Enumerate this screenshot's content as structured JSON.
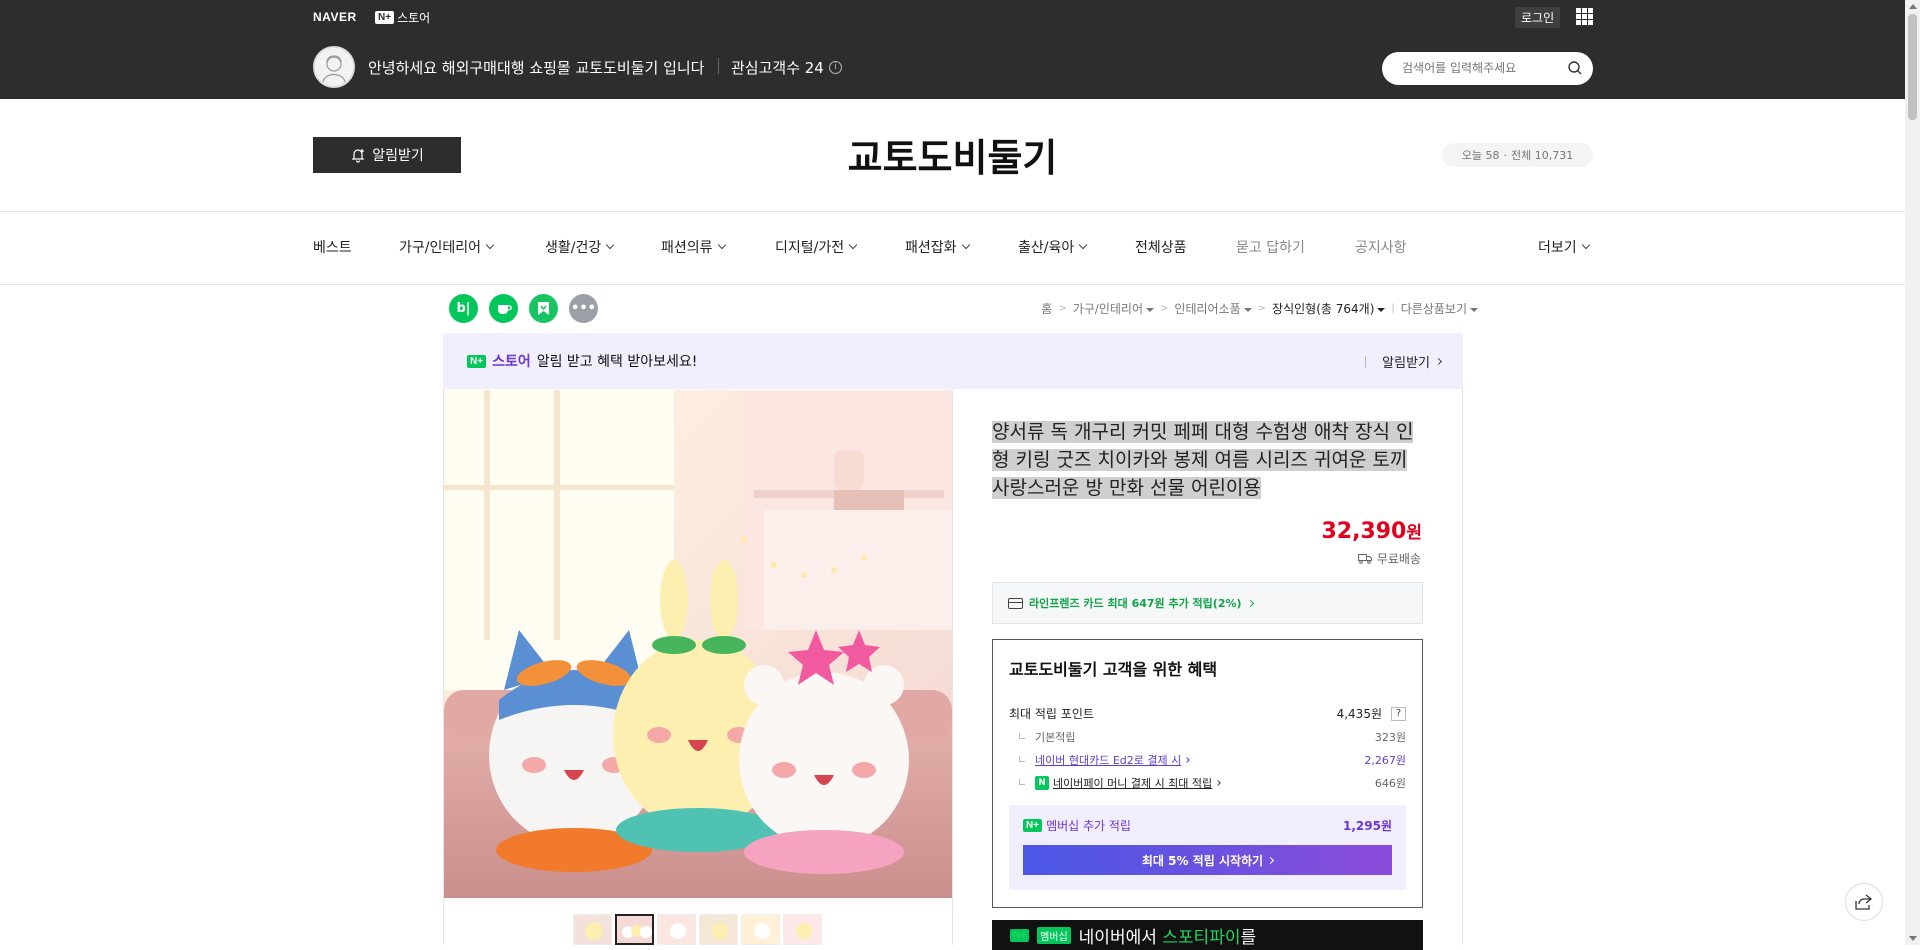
{
  "topbar": {
    "naver_logo": "NAVER",
    "store_badge": "N+",
    "store_label": "스토어",
    "login": "로그인",
    "greeting": "안녕하세요 해외구매대행 쇼핑몰 교토도비둘기 입니다",
    "interest": "관심고객수 24",
    "search_placeholder": "검색어를 입력해주세요"
  },
  "store": {
    "alarm_button": "알림받기",
    "title": "교토도비둘기",
    "visits_today": "오늘 58",
    "visits_total": "전체 10,731"
  },
  "nav": {
    "items": [
      {
        "label": "베스트"
      },
      {
        "label": "가구/인테리어"
      },
      {
        "label": "생활/건강"
      },
      {
        "label": "패션의류"
      },
      {
        "label": "디지털/가전"
      },
      {
        "label": "패션잡화"
      },
      {
        "label": "출산/육아"
      },
      {
        "label": "전체상품"
      },
      {
        "label": "묻고 답하기"
      },
      {
        "label": "공지사항"
      },
      {
        "label": "더보기"
      }
    ]
  },
  "share": {
    "items": [
      {
        "name": "blog",
        "glyph": "b|",
        "color": "#03c75a"
      },
      {
        "name": "cafe",
        "glyph": "☕",
        "color": "#03c75a"
      },
      {
        "name": "band",
        "glyph": "⚑",
        "color": "#19c463"
      },
      {
        "name": "more",
        "glyph": "•••",
        "color": "#9aa0a6"
      }
    ]
  },
  "breadcrumb": {
    "home": "홈",
    "cat1": "가구/인테리어",
    "cat2": "인테리어소품",
    "cat3": "장식인형(총 764개)",
    "other": "다른상품보기"
  },
  "promo": {
    "store_label": "스토어",
    "text": "알림 받고 혜택 받아보세요!",
    "action": "알림받기"
  },
  "product": {
    "title": "양서류 독 개구리 커밋 페페 대형 수험생 애착 장식 인형 키링 굿즈 치이카와 봉제 여름 시리즈 귀여운 토끼 사랑스러운 방 만화 선물 어린이용",
    "price": "32,390",
    "price_unit": "원",
    "shipping": "무료배송",
    "card_benefit": "라인프렌즈 카드 최대 647원 추가 적립(2%)"
  },
  "benefits": {
    "title": "교토도비둘기 고객을 위한 혜택",
    "max_points_label": "최대 적립 포인트",
    "max_points_value": "4,435원",
    "basic_label": "기본적립",
    "basic_value": "323원",
    "hyundai_label": "네이버 현대카드 Ed2로 결제 시",
    "hyundai_value": "2,267원",
    "npay_label": "네이버페이 머니 결제 시 최대 적립",
    "npay_value": "646원",
    "member_label": "멤버십 추가 적립",
    "member_value": "1,295원",
    "member_button": "최대 5% 적립 시작하기"
  },
  "spotify": {
    "badge": "멤버십",
    "text_a": "네이버에서",
    "text_b": "스포티파이",
    "text_c": "를"
  },
  "colors": {
    "accent_price": "#e0001e",
    "naver_green": "#03c75a",
    "membership_purple": "#6b36d7"
  }
}
